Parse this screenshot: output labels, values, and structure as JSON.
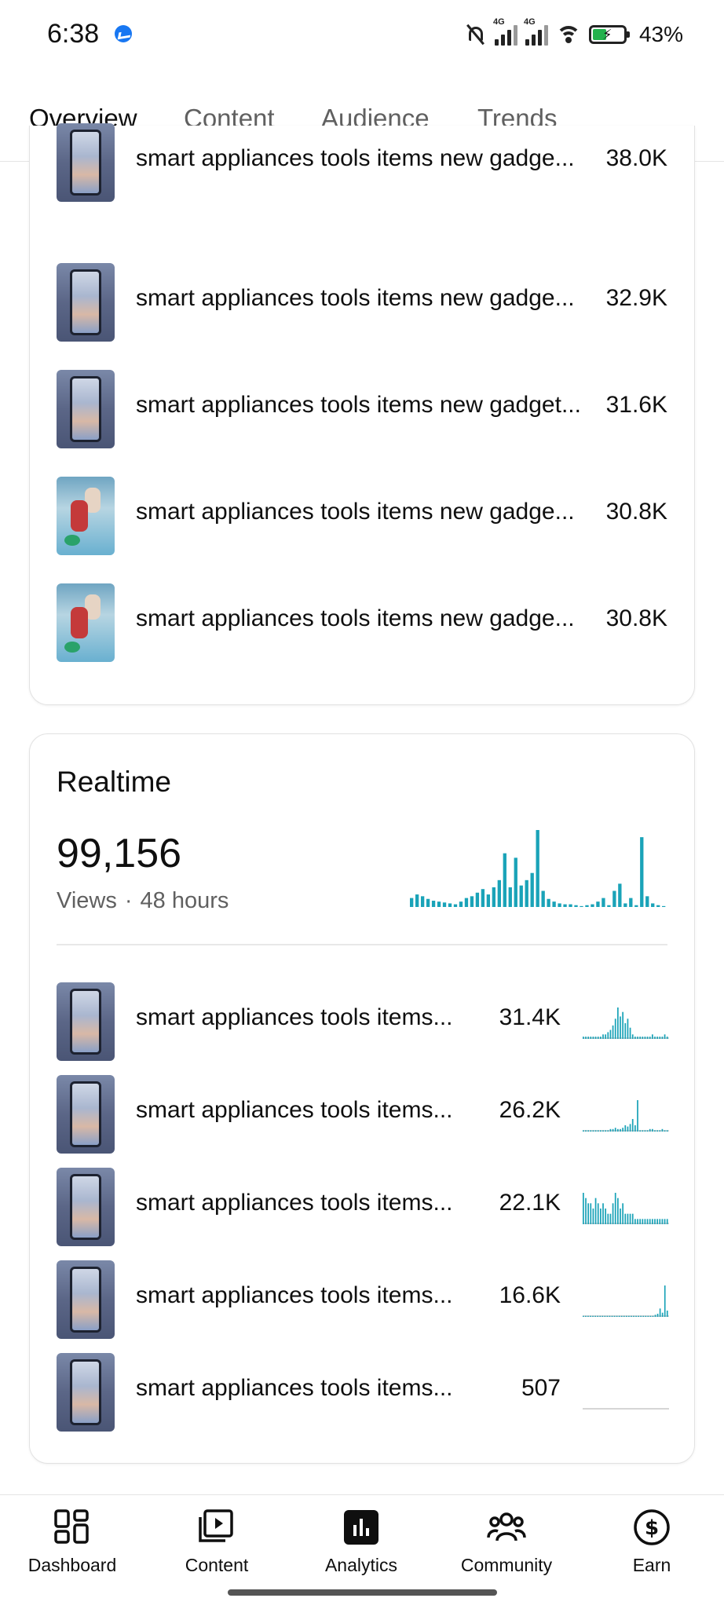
{
  "status_bar": {
    "time": "6:38",
    "battery": "43%",
    "battery_level": 0.43,
    "network_1": "4G",
    "network_2": "4G",
    "icons": [
      "messenger-icon",
      "mute-icon",
      "signal-icon",
      "signal-icon",
      "wifi-icon",
      "battery-charging-icon"
    ]
  },
  "tabs": [
    {
      "label": "Overview",
      "active": true
    },
    {
      "label": "Content",
      "active": false
    },
    {
      "label": "Audience",
      "active": false
    },
    {
      "label": "Trends",
      "active": false
    }
  ],
  "top_content": {
    "items": [
      {
        "title": "smart appliances tools items new gadge...",
        "views": "38.0K"
      },
      {
        "title": "smart appliances tools items new gadge...",
        "views": "32.9K"
      },
      {
        "title": "smart appliances tools items new gadget...",
        "views": "31.6K"
      },
      {
        "title": "smart appliances tools items new gadge...",
        "views": "30.8K"
      },
      {
        "title": "smart appliances tools items new gadge...",
        "views": "30.8K"
      }
    ]
  },
  "realtime": {
    "heading": "Realtime",
    "views": "99,156",
    "views_label": "Views",
    "period": "48 hours",
    "items": [
      {
        "title": "smart appliances tools items...",
        "views": "31.4K"
      },
      {
        "title": "smart appliances tools items...",
        "views": "26.2K"
      },
      {
        "title": "smart appliances tools items...",
        "views": "22.1K"
      },
      {
        "title": "smart appliances tools items...",
        "views": "16.6K"
      },
      {
        "title": "smart appliances tools items...",
        "views": "507"
      }
    ]
  },
  "chart_data": [
    {
      "type": "bar",
      "series": [
        {
          "values": [
            10,
            14,
            12,
            9,
            7,
            6,
            5,
            4,
            3,
            6,
            10,
            12,
            16,
            20,
            14,
            22,
            30,
            60,
            22,
            55,
            24,
            30,
            38,
            86,
            18,
            9,
            6,
            4,
            3,
            3,
            2,
            1,
            2,
            3,
            6,
            10,
            2,
            18,
            26,
            4,
            10,
            2,
            78,
            12,
            4,
            2,
            1
          ]
        }
      ]
    },
    {
      "type": "bar",
      "series": [
        {
          "values": [
            1,
            1,
            1,
            1,
            1,
            1,
            1,
            1,
            2,
            2,
            3,
            4,
            6,
            9,
            14,
            10,
            12,
            7,
            9,
            5,
            2,
            1,
            1,
            1,
            1,
            1,
            1,
            1,
            2,
            1,
            1,
            1,
            1,
            2,
            1
          ]
        }
      ]
    },
    {
      "type": "bar",
      "series": [
        {
          "values": [
            1,
            1,
            1,
            1,
            1,
            1,
            1,
            1,
            1,
            1,
            1,
            2,
            2,
            3,
            2,
            2,
            3,
            5,
            4,
            6,
            10,
            5,
            25,
            1,
            1,
            1,
            1,
            2,
            2,
            1,
            1,
            1,
            2,
            1,
            1
          ]
        }
      ]
    },
    {
      "type": "bar",
      "series": [
        {
          "values": [
            6,
            5,
            4,
            4,
            3,
            5,
            4,
            3,
            4,
            3,
            2,
            2,
            4,
            6,
            5,
            3,
            4,
            2,
            2,
            2,
            2,
            1,
            1,
            1,
            1,
            1,
            1,
            1,
            1,
            1,
            1,
            1,
            1,
            1,
            1
          ]
        }
      ]
    },
    {
      "type": "bar",
      "series": [
        {
          "values": [
            1,
            1,
            1,
            1,
            1,
            1,
            1,
            1,
            1,
            1,
            1,
            1,
            1,
            1,
            1,
            1,
            1,
            1,
            1,
            1,
            1,
            1,
            1,
            1,
            1,
            1,
            1,
            1,
            1,
            1,
            2,
            3,
            8,
            4,
            30,
            6
          ]
        }
      ]
    },
    {
      "type": "bar",
      "series": [
        {
          "values": [
            0,
            0,
            0,
            0,
            0,
            0,
            0,
            0,
            0,
            0,
            0,
            0,
            0,
            0,
            0,
            0,
            0,
            0,
            0,
            0,
            0,
            0,
            0,
            0,
            0,
            0,
            0,
            0,
            0,
            0
          ]
        }
      ]
    }
  ],
  "bottom_nav": [
    {
      "label": "Dashboard",
      "icon": "dashboard-icon"
    },
    {
      "label": "Content",
      "icon": "content-icon"
    },
    {
      "label": "Analytics",
      "icon": "analytics-icon",
      "active": true
    },
    {
      "label": "Community",
      "icon": "community-icon"
    },
    {
      "label": "Earn",
      "icon": "earn-icon"
    }
  ],
  "colors": {
    "accent_chart": "#1aa3b8",
    "text_primary": "#0f0f0f",
    "text_secondary": "#606060"
  }
}
